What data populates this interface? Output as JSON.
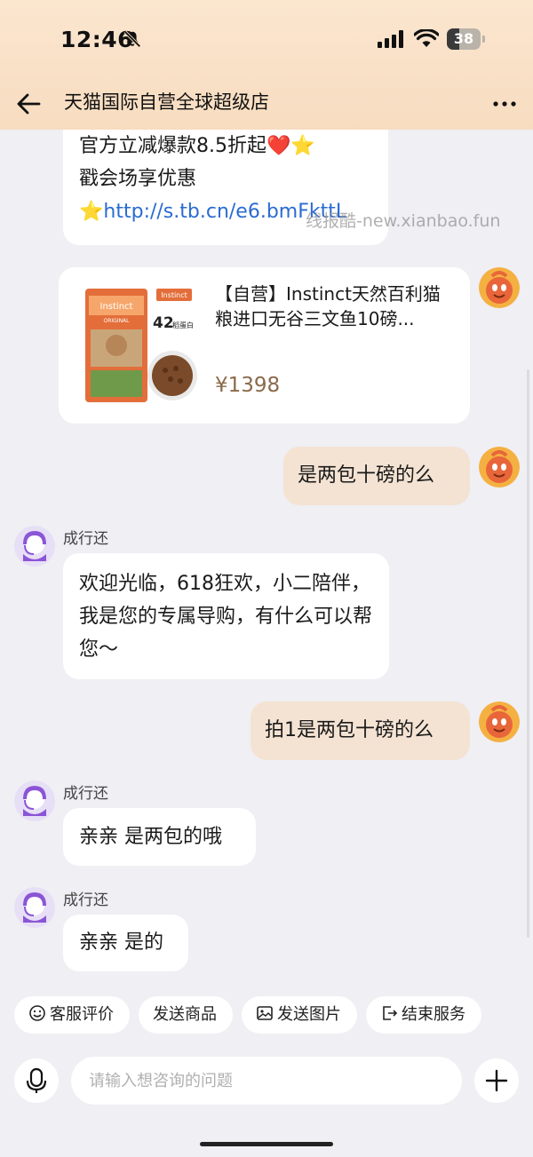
{
  "status_bar": {
    "time": "12:46",
    "battery": "38",
    "battery_level": 0.38
  },
  "nav": {
    "title": "天猫国际自营全球超级店"
  },
  "messages": {
    "promo": {
      "line1": "官方立减爆款8.5折起❤️⭐",
      "line2": "戳会场享优惠",
      "link_prefix": "⭐",
      "link": "http://s.tb.cn/e6.bmFkttL"
    },
    "product": {
      "title": "【自营】Instinct天然百利猫粮进口无谷三文鱼10磅...",
      "price": "¥1398",
      "img_badge_number": "42",
      "img_badge_text": "稻蛋白",
      "img_brand": "Instinct",
      "img_sub": "ORIGINAL"
    },
    "user_msg1": "是两包十磅的么",
    "agent_name": "成行还",
    "agent_msg1": "欢迎光临，618狂欢，小二陪伴，我是您的专属导购，有什么可以帮您～",
    "user_msg2": "拍1是两包十磅的么",
    "agent_msg2": "亲亲 是两包的哦",
    "agent_msg3": "亲亲 是的"
  },
  "watermark": "线报酷-new.xianbao.fun",
  "quick_actions": [
    {
      "label": "客服评价",
      "icon": "smile-icon"
    },
    {
      "label": "发送商品",
      "icon": ""
    },
    {
      "label": "发送图片",
      "icon": "image-icon"
    },
    {
      "label": "结束服务",
      "icon": "exit-icon"
    }
  ],
  "input": {
    "placeholder": "请输入想咨询的问题"
  },
  "colors": {
    "header_bg": "#f7dcc0",
    "user_bubble": "#f4e3d3",
    "link": "#2a6bd1",
    "price": "#8a6a4a"
  }
}
